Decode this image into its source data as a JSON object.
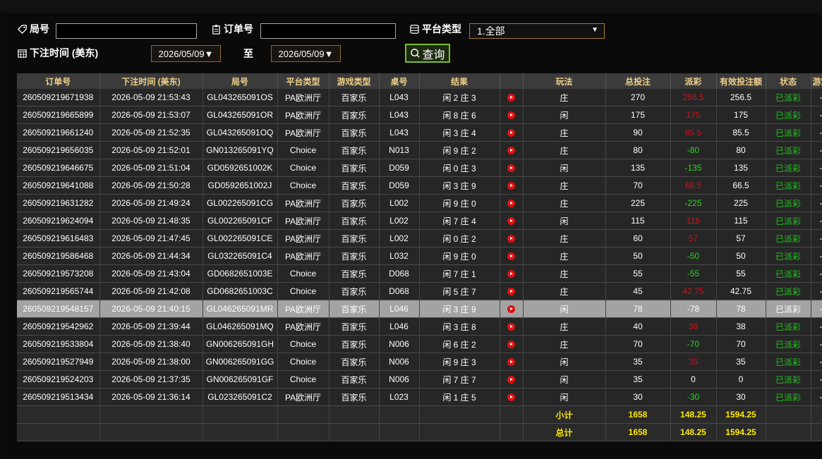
{
  "filters": {
    "game_no_label": "局号",
    "order_no_label": "订单号",
    "platform_label": "平台类型",
    "platform_value": "1.全部",
    "bet_time_label": "下注时间 (美东)",
    "date_from": "2026/05/09▼",
    "to_label": "至",
    "date_to": "2026/05/09▼",
    "query_label": "查询"
  },
  "table": {
    "headers": [
      "订单号",
      "下注时间 (美东)",
      "局号",
      "平台类型",
      "游戏类型",
      "桌号",
      "结果",
      "",
      "玩法",
      "总投注",
      "派彩",
      "有效投注额",
      "状态",
      "游戏"
    ],
    "rows": [
      [
        "260509219671938",
        "2026-05-09 21:53:43",
        "GL043265091OS",
        "PA欧洲厅",
        "百家乐",
        "L043",
        "闲 2 庄 3",
        "庄",
        "270",
        "256.5",
        "256.5",
        "已派彩",
        "-"
      ],
      [
        "260509219665899",
        "2026-05-09 21:53:07",
        "GL043265091OR",
        "PA欧洲厅",
        "百家乐",
        "L043",
        "闲 8 庄 6",
        "闲",
        "175",
        "175",
        "175",
        "已派彩",
        "-"
      ],
      [
        "260509219661240",
        "2026-05-09 21:52:35",
        "GL043265091OQ",
        "PA欧洲厅",
        "百家乐",
        "L043",
        "闲 3 庄 4",
        "庄",
        "90",
        "85.5",
        "85.5",
        "已派彩",
        "-"
      ],
      [
        "260509219656035",
        "2026-05-09 21:52:01",
        "GN013265091YQ",
        "Choice",
        "百家乐",
        "N013",
        "闲 9 庄 2",
        "庄",
        "80",
        "-80",
        "80",
        "已派彩",
        "-"
      ],
      [
        "260509219646675",
        "2026-05-09 21:51:04",
        "GD0592651002K",
        "Choice",
        "百家乐",
        "D059",
        "闲 0 庄 3",
        "闲",
        "135",
        "-135",
        "135",
        "已派彩",
        "-"
      ],
      [
        "260509219641088",
        "2026-05-09 21:50:28",
        "GD0592651002J",
        "Choice",
        "百家乐",
        "D059",
        "闲 3 庄 9",
        "庄",
        "70",
        "66.5",
        "66.5",
        "已派彩",
        "-"
      ],
      [
        "260509219631282",
        "2026-05-09 21:49:24",
        "GL002265091CG",
        "PA欧洲厅",
        "百家乐",
        "L002",
        "闲 9 庄 0",
        "庄",
        "225",
        "-225",
        "225",
        "已派彩",
        "-"
      ],
      [
        "260509219624094",
        "2026-05-09 21:48:35",
        "GL002265091CF",
        "PA欧洲厅",
        "百家乐",
        "L002",
        "闲 7 庄 4",
        "闲",
        "115",
        "115",
        "115",
        "已派彩",
        "-"
      ],
      [
        "260509219616483",
        "2026-05-09 21:47:45",
        "GL002265091CE",
        "PA欧洲厅",
        "百家乐",
        "L002",
        "闲 0 庄 2",
        "庄",
        "60",
        "57",
        "57",
        "已派彩",
        "-"
      ],
      [
        "260509219586468",
        "2026-05-09 21:44:34",
        "GL032265091C4",
        "PA欧洲厅",
        "百家乐",
        "L032",
        "闲 9 庄 0",
        "庄",
        "50",
        "-50",
        "50",
        "已派彩",
        "-"
      ],
      [
        "260509219573208",
        "2026-05-09 21:43:04",
        "GD0682651003E",
        "Choice",
        "百家乐",
        "D068",
        "闲 7 庄 1",
        "庄",
        "55",
        "-55",
        "55",
        "已派彩",
        "-"
      ],
      [
        "260509219565744",
        "2026-05-09 21:42:08",
        "GD0682651003C",
        "Choice",
        "百家乐",
        "D068",
        "闲 5 庄 7",
        "庄",
        "45",
        "42.75",
        "42.75",
        "已派彩",
        "-"
      ],
      [
        "260509219548157",
        "2026-05-09 21:40:15",
        "GL046265091MR",
        "PA欧洲厅",
        "百家乐",
        "L046",
        "闲 3 庄 9",
        "闲",
        "78",
        "-78",
        "78",
        "已派彩",
        "-"
      ],
      [
        "260509219542962",
        "2026-05-09 21:39:44",
        "GL046265091MQ",
        "PA欧洲厅",
        "百家乐",
        "L046",
        "闲 3 庄 8",
        "庄",
        "40",
        "38",
        "38",
        "已派彩",
        "-"
      ],
      [
        "260509219533804",
        "2026-05-09 21:38:40",
        "GN006265091GH",
        "Choice",
        "百家乐",
        "N006",
        "闲 6 庄 2",
        "庄",
        "70",
        "-70",
        "70",
        "已派彩",
        "-"
      ],
      [
        "260509219527949",
        "2026-05-09 21:38:00",
        "GN006265091GG",
        "Choice",
        "百家乐",
        "N006",
        "闲 9 庄 3",
        "闲",
        "35",
        "35",
        "35",
        "已派彩",
        "-"
      ],
      [
        "260509219524203",
        "2026-05-09 21:37:35",
        "GN006265091GF",
        "Choice",
        "百家乐",
        "N006",
        "闲 7 庄 7",
        "闲",
        "35",
        "0",
        "0",
        "已派彩",
        "-"
      ],
      [
        "260509219513434",
        "2026-05-09 21:36:14",
        "GL023265091C2",
        "PA欧洲厅",
        "百家乐",
        "L023",
        "闲 1 庄 5",
        "闲",
        "30",
        "-30",
        "30",
        "已派彩",
        "-"
      ]
    ],
    "subtotal": {
      "label": "小计",
      "total_bet": "1658",
      "payout": "148.25",
      "valid_bet": "1594.25"
    },
    "total": {
      "label": "总计",
      "total_bet": "1658",
      "payout": "148.25",
      "valid_bet": "1594.25"
    }
  },
  "colors": {
    "loss_red": "#c01820",
    "win_green": "#2ad620",
    "paid_green": "#22c41e",
    "total_yellow": "#ffea00",
    "header_text": "#f0d088"
  },
  "icons": {
    "game_no": "tag-icon",
    "order_no": "clipboard-icon",
    "platform": "list-icon",
    "bet_time": "calendar-icon",
    "query": "search-icon",
    "replay": "video-play-icon"
  }
}
